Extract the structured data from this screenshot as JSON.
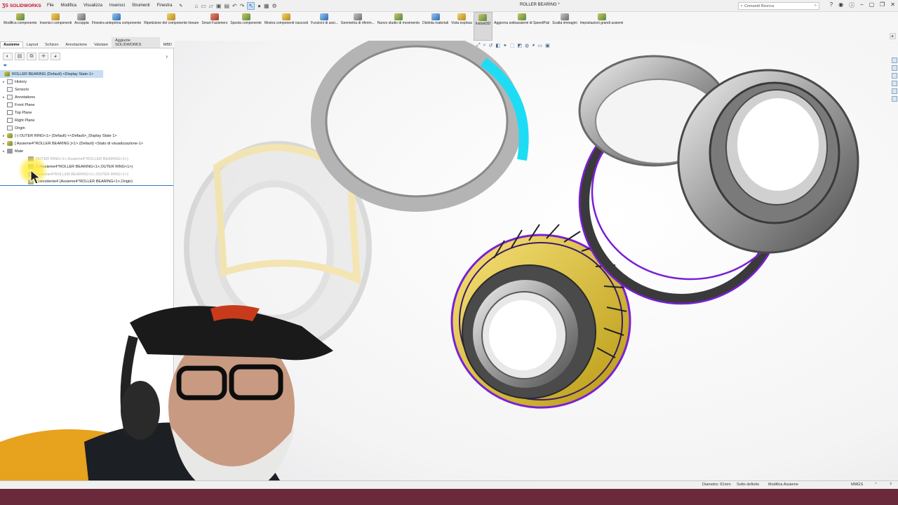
{
  "app": {
    "brand": "SOLIDWORKS",
    "menus": [
      "File",
      "Modifica",
      "Visualizza",
      "Inserisci",
      "Strumenti",
      "Finestra"
    ],
    "document_title": "ROLLER BEARING *",
    "search_placeholder": "Comandi Ricerca"
  },
  "ribbon": [
    {
      "label": "Modifica componente",
      "color": "g"
    },
    {
      "label": "Inserisci componenti",
      "color": "y"
    },
    {
      "label": "Accoppia",
      "color": "gr"
    },
    {
      "label": "Finestra anteprima componente",
      "color": "b"
    },
    {
      "label": "Ripetizione del componente lineare",
      "color": "y"
    },
    {
      "label": "Smart Fasteners",
      "color": "r"
    },
    {
      "label": "Sposta componente",
      "color": "g"
    },
    {
      "label": "Mostra componenti nascosti",
      "color": "y"
    },
    {
      "label": "Funzioni di assi...",
      "color": "b"
    },
    {
      "label": "Geometria di riferim...",
      "color": "gr"
    },
    {
      "label": "Nuovo studio di movimento",
      "color": "g"
    },
    {
      "label": "Distinta materiali",
      "color": "b"
    },
    {
      "label": "Vista esplosa",
      "color": "y"
    },
    {
      "label": "Instant3D",
      "color": "g",
      "active": true
    },
    {
      "label": "Aggiorna sottoassiemi di SpeedPak",
      "color": "g"
    },
    {
      "label": "Scatta immagini",
      "color": "gr"
    },
    {
      "label": "Impostazioni grandi assiemi",
      "color": "g"
    }
  ],
  "command_tabs": [
    {
      "label": "Assieme",
      "active": true
    },
    {
      "label": "Layout"
    },
    {
      "label": "Schizzo"
    },
    {
      "label": "Annotazione"
    },
    {
      "label": "Valutare"
    },
    {
      "label": "Aggiunte SOLIDWORKS"
    },
    {
      "label": "MBD"
    }
  ],
  "tree": {
    "root": "ROLLER BEARING (Default) <Display State-1>",
    "items": [
      {
        "label": "History",
        "icon": "folder-icon",
        "expandable": true
      },
      {
        "label": "Sensors",
        "icon": "sensor-icon"
      },
      {
        "label": "Annotations",
        "icon": "annotation-icon",
        "expandable": true
      },
      {
        "label": "Front Plane",
        "icon": "plane-icon"
      },
      {
        "label": "Top Plane",
        "icon": "plane-icon"
      },
      {
        "label": "Right Plane",
        "icon": "plane-icon"
      },
      {
        "label": "Origin",
        "icon": "origin-icon"
      },
      {
        "label": "(-) OUTER RING<1> (Default) <<Default>_Display State 1>",
        "icon": "component-icon",
        "expandable": true
      },
      {
        "label": "[ Assieme4^ROLLER BEARING ]<1> (Default) <Stato di visualizzazione-1>",
        "icon": "component-icon",
        "expandable": true
      },
      {
        "label": "Mate",
        "icon": "mates-icon",
        "expandable": true
      },
      {
        "label": "OUTER RING<1>,Assieme4^ROLLER BEARING<1>)",
        "icon": "mate-icon",
        "faded": true
      },
      {
        "label": "3 (Assieme4^ROLLER BEARING<1>,OUTER RING<1>)",
        "icon": "mate-icon"
      },
      {
        "label": "Assieme4^ROLLER BEARING<1>,OUTER RING<1>)",
        "icon": "mate-icon",
        "faded": true
      },
      {
        "label": "Coincidente4 (Assieme4^ROLLER BEARING<1>,Origin)",
        "icon": "mate-icon",
        "underline": true
      }
    ]
  },
  "status": {
    "diameter": "Diametro: 61mm",
    "definition": "Sotto definito",
    "mode": "Modifica Assieme",
    "units": "MMGS"
  },
  "colors": {
    "accent": "#2a7bc8",
    "gold": "#e6c21a",
    "purple": "#7a1fd6",
    "cyan": "#18d8f0",
    "strip": "#6a2a3b"
  }
}
